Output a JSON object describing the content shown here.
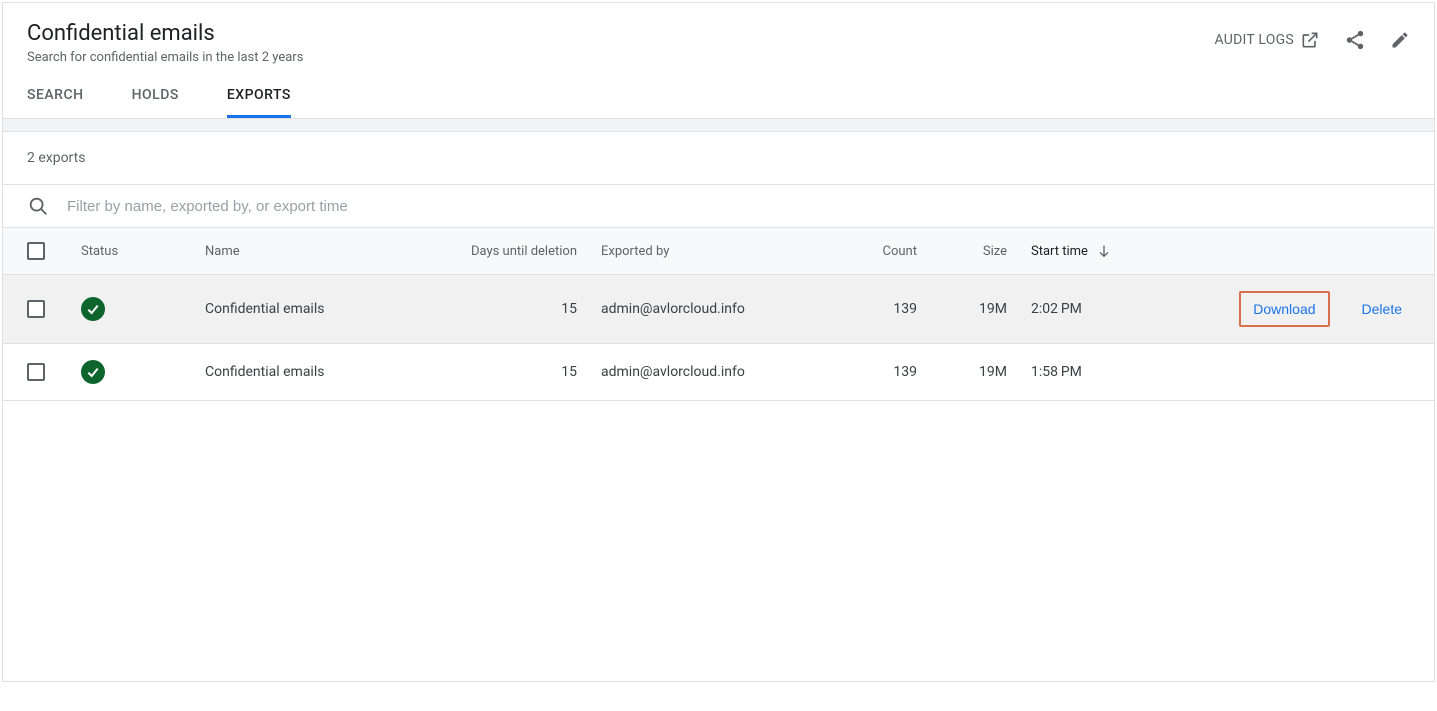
{
  "header": {
    "title": "Confidential emails",
    "subtitle": "Search for confidential emails in the last 2 years",
    "audit_logs_label": "AUDIT LOGS"
  },
  "tabs": [
    {
      "label": "SEARCH",
      "active": false
    },
    {
      "label": "HOLDS",
      "active": false
    },
    {
      "label": "EXPORTS",
      "active": true
    }
  ],
  "exports_count_label": "2 exports",
  "filter": {
    "placeholder": "Filter by name, exported by, or export time"
  },
  "columns": {
    "status": "Status",
    "name": "Name",
    "days": "Days until deletion",
    "exported_by": "Exported by",
    "count": "Count",
    "size": "Size",
    "start_time": "Start time"
  },
  "sort": {
    "column": "start_time",
    "direction": "desc"
  },
  "rows": [
    {
      "name": "Confidential emails",
      "days": "15",
      "exported_by": "admin@avlorcloud.info",
      "count": "139",
      "size": "19M",
      "start_time": "2:02 PM",
      "download_label": "Download",
      "delete_label": "Delete",
      "highlighted": true,
      "show_actions": true
    },
    {
      "name": "Confidential emails",
      "days": "15",
      "exported_by": "admin@avlorcloud.info",
      "count": "139",
      "size": "19M",
      "start_time": "1:58 PM",
      "highlighted": false,
      "show_actions": false
    }
  ]
}
